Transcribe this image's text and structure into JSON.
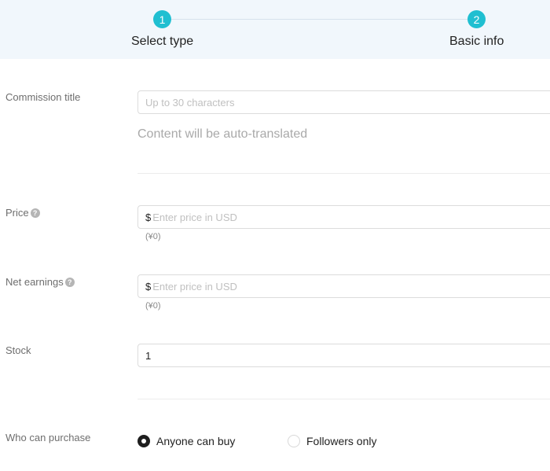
{
  "stepper": {
    "steps": [
      {
        "number": "1",
        "label": "Select type"
      },
      {
        "number": "2",
        "label": "Basic info"
      }
    ]
  },
  "commission_title": {
    "label": "Commission title",
    "placeholder": "Up to 30 characters",
    "value": "",
    "note": "Content will be auto-translated"
  },
  "price": {
    "label": "Price",
    "help": "?",
    "currency_symbol": "$",
    "placeholder": "Enter price in USD",
    "value": "",
    "converted": "(¥0)"
  },
  "net_earnings": {
    "label": "Net earnings",
    "help": "?",
    "currency_symbol": "$",
    "placeholder": "Enter price in USD",
    "value": "",
    "converted": "(¥0)"
  },
  "stock": {
    "label": "Stock",
    "value": "1"
  },
  "who_can_purchase": {
    "label": "Who can purchase",
    "options": [
      {
        "label": "Anyone can buy",
        "selected": true
      },
      {
        "label": "Followers only",
        "selected": false
      }
    ]
  },
  "colors": {
    "accent": "#20bfd1",
    "stepper_bg": "#f1f7fc"
  }
}
